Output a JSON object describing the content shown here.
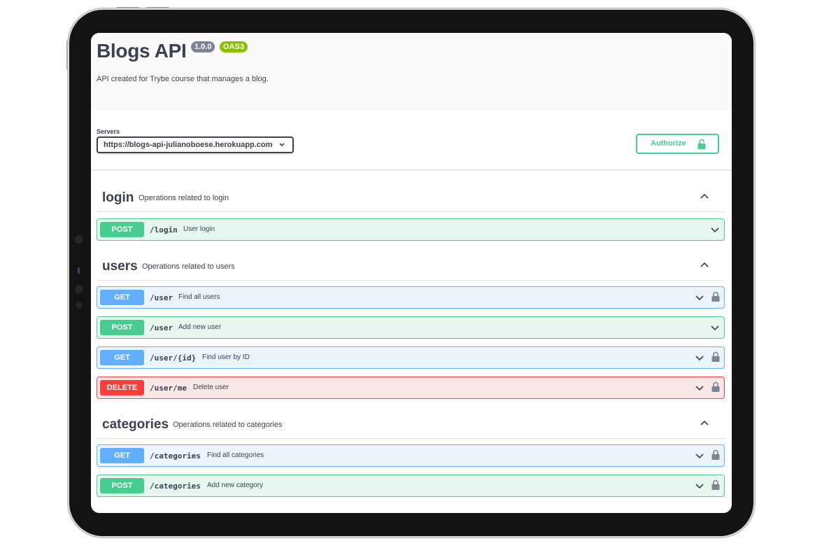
{
  "info": {
    "title": "Blogs API",
    "version": "1.0.0",
    "oas_badge": "OAS3",
    "description": "API created for Trybe course that manages a blog."
  },
  "servers": {
    "label": "Servers",
    "selected": "https://blogs-api-julianoboese.herokuapp.com"
  },
  "authorize": {
    "label": "Authorize"
  },
  "tags": [
    {
      "name": "login",
      "description": "Operations related to login",
      "operations": [
        {
          "method": "POST",
          "path": "/login",
          "summary": "User login",
          "locked": false
        }
      ]
    },
    {
      "name": "users",
      "description": "Operations related to users",
      "operations": [
        {
          "method": "GET",
          "path": "/user",
          "summary": "Find all users",
          "locked": true
        },
        {
          "method": "POST",
          "path": "/user",
          "summary": "Add new user",
          "locked": false
        },
        {
          "method": "GET",
          "path": "/user/{id}",
          "summary": "Find user by ID",
          "locked": true
        },
        {
          "method": "DELETE",
          "path": "/user/me",
          "summary": "Delete user",
          "locked": true
        }
      ]
    },
    {
      "name": "categories",
      "description": "Operations related to categories",
      "operations": [
        {
          "method": "GET",
          "path": "/categories",
          "summary": "Find all categories",
          "locked": true
        },
        {
          "method": "POST",
          "path": "/categories",
          "summary": "Add new category",
          "locked": true
        }
      ]
    }
  ],
  "colors": {
    "get": "#61affe",
    "post": "#49cc90",
    "delete": "#f93e3e",
    "text": "#3b4151"
  }
}
